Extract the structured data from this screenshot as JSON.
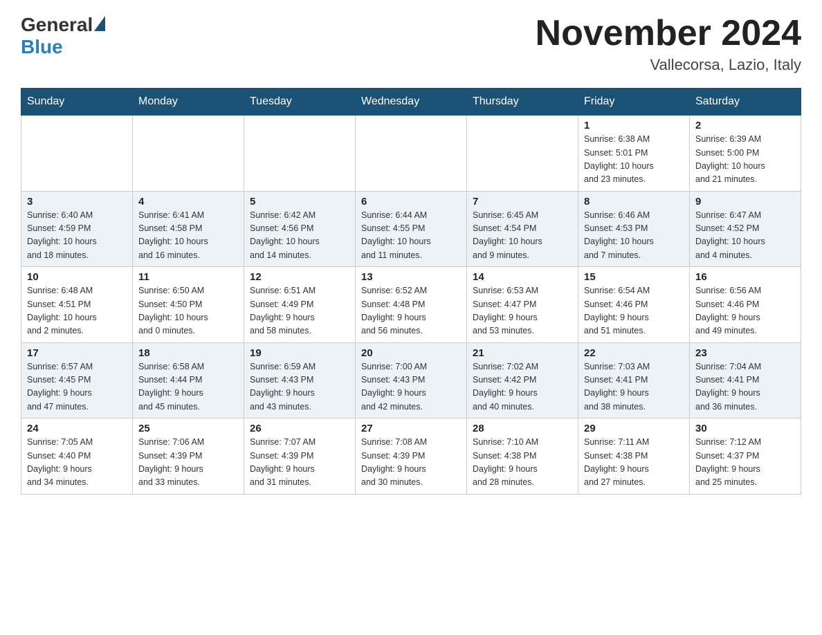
{
  "header": {
    "logo_general": "General",
    "logo_blue": "Blue",
    "month_title": "November 2024",
    "location": "Vallecorsa, Lazio, Italy"
  },
  "days_of_week": [
    "Sunday",
    "Monday",
    "Tuesday",
    "Wednesday",
    "Thursday",
    "Friday",
    "Saturday"
  ],
  "weeks": [
    [
      {
        "day": "",
        "info": ""
      },
      {
        "day": "",
        "info": ""
      },
      {
        "day": "",
        "info": ""
      },
      {
        "day": "",
        "info": ""
      },
      {
        "day": "",
        "info": ""
      },
      {
        "day": "1",
        "info": "Sunrise: 6:38 AM\nSunset: 5:01 PM\nDaylight: 10 hours\nand 23 minutes."
      },
      {
        "day": "2",
        "info": "Sunrise: 6:39 AM\nSunset: 5:00 PM\nDaylight: 10 hours\nand 21 minutes."
      }
    ],
    [
      {
        "day": "3",
        "info": "Sunrise: 6:40 AM\nSunset: 4:59 PM\nDaylight: 10 hours\nand 18 minutes."
      },
      {
        "day": "4",
        "info": "Sunrise: 6:41 AM\nSunset: 4:58 PM\nDaylight: 10 hours\nand 16 minutes."
      },
      {
        "day": "5",
        "info": "Sunrise: 6:42 AM\nSunset: 4:56 PM\nDaylight: 10 hours\nand 14 minutes."
      },
      {
        "day": "6",
        "info": "Sunrise: 6:44 AM\nSunset: 4:55 PM\nDaylight: 10 hours\nand 11 minutes."
      },
      {
        "day": "7",
        "info": "Sunrise: 6:45 AM\nSunset: 4:54 PM\nDaylight: 10 hours\nand 9 minutes."
      },
      {
        "day": "8",
        "info": "Sunrise: 6:46 AM\nSunset: 4:53 PM\nDaylight: 10 hours\nand 7 minutes."
      },
      {
        "day": "9",
        "info": "Sunrise: 6:47 AM\nSunset: 4:52 PM\nDaylight: 10 hours\nand 4 minutes."
      }
    ],
    [
      {
        "day": "10",
        "info": "Sunrise: 6:48 AM\nSunset: 4:51 PM\nDaylight: 10 hours\nand 2 minutes."
      },
      {
        "day": "11",
        "info": "Sunrise: 6:50 AM\nSunset: 4:50 PM\nDaylight: 10 hours\nand 0 minutes."
      },
      {
        "day": "12",
        "info": "Sunrise: 6:51 AM\nSunset: 4:49 PM\nDaylight: 9 hours\nand 58 minutes."
      },
      {
        "day": "13",
        "info": "Sunrise: 6:52 AM\nSunset: 4:48 PM\nDaylight: 9 hours\nand 56 minutes."
      },
      {
        "day": "14",
        "info": "Sunrise: 6:53 AM\nSunset: 4:47 PM\nDaylight: 9 hours\nand 53 minutes."
      },
      {
        "day": "15",
        "info": "Sunrise: 6:54 AM\nSunset: 4:46 PM\nDaylight: 9 hours\nand 51 minutes."
      },
      {
        "day": "16",
        "info": "Sunrise: 6:56 AM\nSunset: 4:46 PM\nDaylight: 9 hours\nand 49 minutes."
      }
    ],
    [
      {
        "day": "17",
        "info": "Sunrise: 6:57 AM\nSunset: 4:45 PM\nDaylight: 9 hours\nand 47 minutes."
      },
      {
        "day": "18",
        "info": "Sunrise: 6:58 AM\nSunset: 4:44 PM\nDaylight: 9 hours\nand 45 minutes."
      },
      {
        "day": "19",
        "info": "Sunrise: 6:59 AM\nSunset: 4:43 PM\nDaylight: 9 hours\nand 43 minutes."
      },
      {
        "day": "20",
        "info": "Sunrise: 7:00 AM\nSunset: 4:43 PM\nDaylight: 9 hours\nand 42 minutes."
      },
      {
        "day": "21",
        "info": "Sunrise: 7:02 AM\nSunset: 4:42 PM\nDaylight: 9 hours\nand 40 minutes."
      },
      {
        "day": "22",
        "info": "Sunrise: 7:03 AM\nSunset: 4:41 PM\nDaylight: 9 hours\nand 38 minutes."
      },
      {
        "day": "23",
        "info": "Sunrise: 7:04 AM\nSunset: 4:41 PM\nDaylight: 9 hours\nand 36 minutes."
      }
    ],
    [
      {
        "day": "24",
        "info": "Sunrise: 7:05 AM\nSunset: 4:40 PM\nDaylight: 9 hours\nand 34 minutes."
      },
      {
        "day": "25",
        "info": "Sunrise: 7:06 AM\nSunset: 4:39 PM\nDaylight: 9 hours\nand 33 minutes."
      },
      {
        "day": "26",
        "info": "Sunrise: 7:07 AM\nSunset: 4:39 PM\nDaylight: 9 hours\nand 31 minutes."
      },
      {
        "day": "27",
        "info": "Sunrise: 7:08 AM\nSunset: 4:39 PM\nDaylight: 9 hours\nand 30 minutes."
      },
      {
        "day": "28",
        "info": "Sunrise: 7:10 AM\nSunset: 4:38 PM\nDaylight: 9 hours\nand 28 minutes."
      },
      {
        "day": "29",
        "info": "Sunrise: 7:11 AM\nSunset: 4:38 PM\nDaylight: 9 hours\nand 27 minutes."
      },
      {
        "day": "30",
        "info": "Sunrise: 7:12 AM\nSunset: 4:37 PM\nDaylight: 9 hours\nand 25 minutes."
      }
    ]
  ]
}
